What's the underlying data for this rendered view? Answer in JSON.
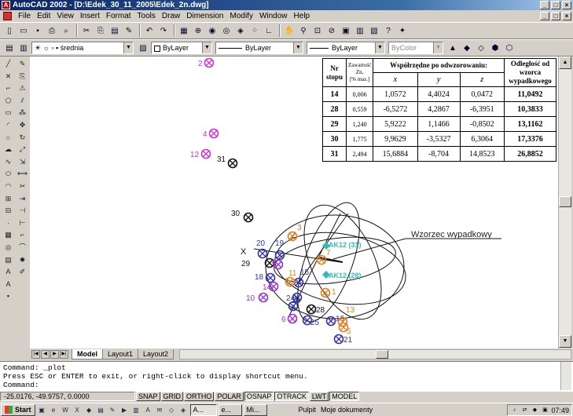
{
  "window": {
    "title": "AutoCAD 2002 - [D:\\Edek_30_11_2005\\Edek_2n.dwg]",
    "minimize": "_",
    "maximize": "□",
    "close": "×"
  },
  "menu": {
    "items": [
      "File",
      "Edit",
      "View",
      "Insert",
      "Format",
      "Tools",
      "Draw",
      "Dimension",
      "Modify",
      "Window",
      "Help"
    ]
  },
  "toolbar": {
    "layer_value": "średnia",
    "color_value": "ByLayer",
    "linetype_value": "ByLayer",
    "lineweight_value": "ByLayer",
    "plotstyle_value": "ByColor"
  },
  "table": {
    "header_nr": "Nr stopu",
    "header_zawartosc": "Zawartość",
    "header_zn": "Zn,",
    "header_unit": "[% mas.]",
    "header_coords": "Współrzędne po odwzorowaniu:",
    "header_x": "x",
    "header_y": "y",
    "header_z": "z",
    "header_dist": "Odległość od wzorca wypadkowego",
    "rows": [
      {
        "nr": "14",
        "zn": "0,006",
        "x": "1,0572",
        "y": "4,4024",
        "z": "0,0472",
        "d": "11,0492"
      },
      {
        "nr": "28",
        "zn": "0,559",
        "x": "-6,5272",
        "y": "4,2867",
        "z": "-6,3951",
        "d": "10,3833"
      },
      {
        "nr": "29",
        "zn": "1,240",
        "x": "5,9222",
        "y": "1,1466",
        "z": "-0,8502",
        "d": "13,1162"
      },
      {
        "nr": "30",
        "zn": "1,775",
        "x": "9,9629",
        "y": "-3,5327",
        "z": "6,3064",
        "d": "17,3376"
      },
      {
        "nr": "31",
        "zn": "2,494",
        "x": "15,6884",
        "y": "-8,704",
        "z": "14,8523",
        "d": "26,8852"
      }
    ]
  },
  "drawing": {
    "annotation": "Wzorzec wypadkowy",
    "points_magenta": [
      "2",
      "4",
      "12"
    ],
    "points_black": [
      "31",
      "30",
      "29",
      "28"
    ],
    "points_blue": [
      "20",
      "19",
      "18",
      "15",
      "16",
      "21",
      "25",
      "23",
      "24"
    ],
    "points_orange": [
      "3",
      "7",
      "1",
      "11",
      "13",
      "5"
    ],
    "points_purple": [
      "8",
      "14",
      "6",
      "10"
    ],
    "cyan_labels": [
      "AK12 (31)",
      "AK12 (28)"
    ],
    "axis_labels": [
      "X",
      "Z",
      "Y"
    ],
    "colors": {
      "magenta": "#cc33cc",
      "black": "#111111",
      "blue": "#3333aa",
      "orange": "#e08020",
      "purple": "#9933cc",
      "cyan": "#33bbbb"
    }
  },
  "tabs": [
    "Model",
    "Layout1",
    "Layout2"
  ],
  "command": {
    "line1": "Command: _plot",
    "line2": "Press ESC or ENTER to exit, or right-click to display shortcut menu.",
    "line3": "Command:"
  },
  "status": {
    "coords": "-25.0176, -49.9757, 0.0000",
    "buttons": [
      "SNAP",
      "GRID",
      "ORTHO",
      "POLAR",
      "OSNAP",
      "OTRACK",
      "LWT",
      "MODEL"
    ]
  },
  "taskbar": {
    "start": "Start",
    "items": [
      "A...",
      "e...",
      "Mi..."
    ],
    "pulpit": "Pulpit",
    "moje_dokumenty": "Moje dokumenty",
    "clock": "07:49"
  }
}
